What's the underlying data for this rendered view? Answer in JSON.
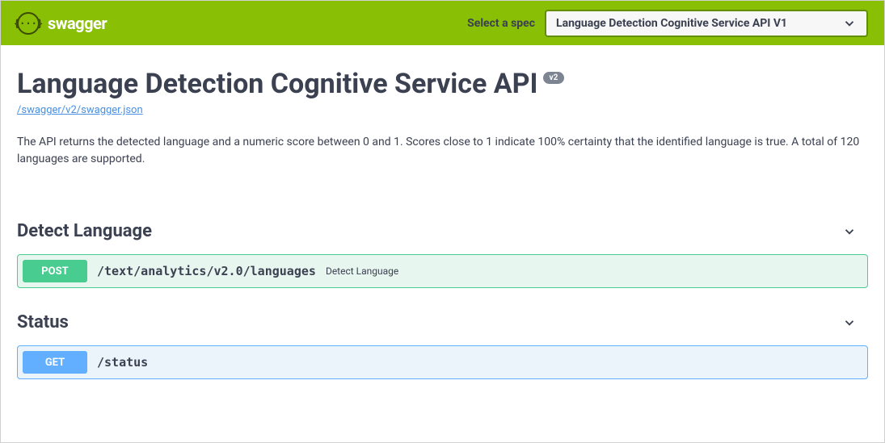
{
  "topbar": {
    "logo_symbol": "{···}",
    "logo_text": "swagger",
    "spec_label": "Select a spec",
    "spec_selected": "Language Detection Cognitive Service API V1"
  },
  "info": {
    "title": "Language Detection Cognitive Service API",
    "version": "v2",
    "spec_url": "/swagger/v2/swagger.json",
    "description": "The API returns the detected language and a numeric score between 0 and 1. Scores close to 1 indicate 100% certainty that the identified language is true. A total of 120 languages are supported."
  },
  "tags": {
    "detect": {
      "name": "Detect Language",
      "operation": {
        "method": "POST",
        "path": "/text/analytics/v2.0/languages",
        "summary": "Detect Language"
      }
    },
    "status": {
      "name": "Status",
      "operation": {
        "method": "GET",
        "path": "/status"
      }
    }
  }
}
